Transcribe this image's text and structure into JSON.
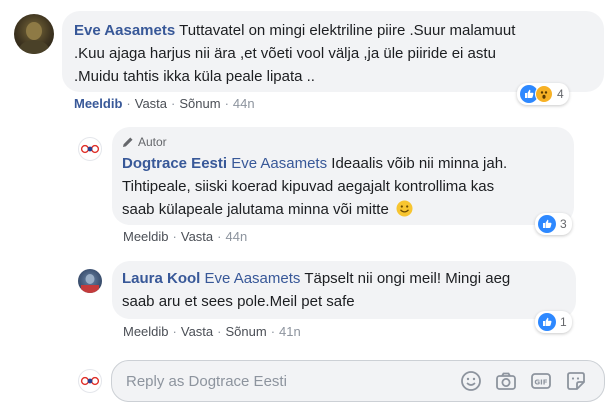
{
  "comment1": {
    "author": "Eve Aasamets",
    "text_line1": "Tuttavatel on mingi elektriline piire .Suur malamuut",
    "text_line2": ".Kuu ajaga harjus nii ära ,et võeti vool välja ,ja üle piiride ei astu",
    "text_line3": ".Muidu tahtis ikka küla peale lipata ..",
    "actions": {
      "like": "Meeldib",
      "reply": "Vasta",
      "message": "Sõnum",
      "time": "44n"
    },
    "reaction_count": "4"
  },
  "reply1": {
    "badge": "Autor",
    "author": "Dogtrace Eesti",
    "mention": "Eve Aasamets",
    "text_line1_rest": "Ideaalis võib nii minna jah.",
    "text_line2": "Tihtipeale, siiski koerad kipuvad aegajalt kontrollima kas",
    "text_line3": "saab külapeale jalutama minna või mitte",
    "actions": {
      "like": "Meeldib",
      "reply": "Vasta",
      "time": "44n"
    },
    "reaction_count": "3"
  },
  "reply2": {
    "author": "Laura Kool",
    "mention": "Eve Aasamets",
    "text_line1_rest": "Täpselt nii ongi meil! Mingi aeg",
    "text_line2": "saab aru et sees pole.Meil pet safe",
    "actions": {
      "like": "Meeldib",
      "reply": "Vasta",
      "message": "Sõnum",
      "time": "41n"
    },
    "reaction_count": "1"
  },
  "reply_box": {
    "placeholder": "Reply as Dogtrace Eesti"
  },
  "colors": {
    "link_blue": "#385898",
    "bubble_bg": "#f2f3f5",
    "like_blue": "#2d88ff",
    "muted": "#8d949e"
  }
}
